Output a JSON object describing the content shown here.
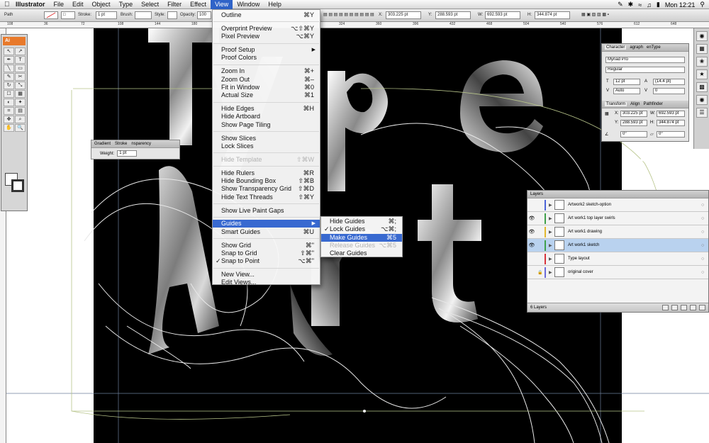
{
  "menubar": {
    "apple": "",
    "app": "Illustrator",
    "items": [
      "File",
      "Edit",
      "Object",
      "Type",
      "Select",
      "Filter",
      "Effect",
      "View",
      "Window",
      "Help"
    ],
    "active": "View",
    "clock": "Mon 12:21"
  },
  "controlbar": {
    "mode": "Path",
    "stroke_label": "Stroke:",
    "stroke_value": "1 pt",
    "brush_label": "Brush:",
    "style_label": "Style:",
    "opacity_label": "Opacity:",
    "opacity_value": "100",
    "x_label": "X:",
    "x_value": "303.225 pt",
    "y_label": "Y:",
    "y_value": "288.593 pt",
    "w_label": "W:",
    "w_value": "692.593 pt",
    "h_label": "H:",
    "h_value": "344.874 pt"
  },
  "ruler": {
    "ticks": [
      "108",
      "36",
      "72",
      "108",
      "144",
      "180",
      "216",
      "252",
      "288",
      "324",
      "360",
      "396",
      "432",
      "468",
      "504",
      "540",
      "576",
      "612",
      "648"
    ]
  },
  "tools": {
    "logo": "Ai",
    "buttons": [
      "↖",
      "↗",
      "✒",
      "T",
      "╲",
      "▭",
      "✎",
      "✂",
      "↻",
      "⤡",
      "☐",
      "▦",
      "◐",
      "✦",
      "⌗",
      "▤",
      "✥",
      "⌕",
      "✋",
      "🔍"
    ]
  },
  "stroke_panel": {
    "tabs": [
      "Gradient",
      "Stroke",
      "nsparency"
    ],
    "weight_label": "Weight:",
    "weight_value": "1 pt"
  },
  "char_panel": {
    "tabs": [
      "Character",
      "agraph",
      "enType"
    ],
    "font": "Myriad Pro",
    "style": "Regular",
    "size": "12 pt",
    "leading": "(14.4 pt)",
    "kerning": "Auto",
    "tracking": "0",
    "transform_tabs": [
      "Transform",
      "Align",
      "Pathfinder"
    ],
    "x": "303.225 pt",
    "y": "288.593 pt",
    "w": "692.593 pt",
    "h": "344.874 pt",
    "rotate": "0°",
    "shear": "0°"
  },
  "layers": {
    "title": "Layers",
    "items": [
      {
        "name": "Artwork2 sketch-option",
        "color": "#4a63d8",
        "visible": false,
        "locked": false,
        "selected": false
      },
      {
        "name": "Art work1 top layer swirls",
        "color": "#3fa04a",
        "visible": true,
        "locked": false,
        "selected": false
      },
      {
        "name": "Art work1 drawing",
        "color": "#e2b72f",
        "visible": true,
        "locked": false,
        "selected": false
      },
      {
        "name": "Art work1 sketch",
        "color": "#3fa04a",
        "visible": true,
        "locked": false,
        "selected": true
      },
      {
        "name": "Type layout",
        "color": "#d8343a",
        "visible": false,
        "locked": false,
        "selected": false
      },
      {
        "name": "original cover",
        "color": "#6b6bd8",
        "visible": false,
        "locked": true,
        "selected": false
      }
    ],
    "footer": "6 Layers"
  },
  "view_menu": {
    "items": [
      {
        "label": "Outline",
        "shortcut": "⌘Y"
      },
      {
        "sep": true
      },
      {
        "label": "Overprint Preview",
        "shortcut": "⌥⇧⌘Y"
      },
      {
        "label": "Pixel Preview",
        "shortcut": "⌥⌘Y"
      },
      {
        "sep": true
      },
      {
        "label": "Proof Setup",
        "submenu": true
      },
      {
        "label": "Proof Colors"
      },
      {
        "sep": true
      },
      {
        "label": "Zoom In",
        "shortcut": "⌘+"
      },
      {
        "label": "Zoom Out",
        "shortcut": "⌘–"
      },
      {
        "label": "Fit in Window",
        "shortcut": "⌘0"
      },
      {
        "label": "Actual Size",
        "shortcut": "⌘1"
      },
      {
        "sep": true
      },
      {
        "label": "Hide Edges",
        "shortcut": "⌘H"
      },
      {
        "label": "Hide Artboard"
      },
      {
        "label": "Show Page Tiling"
      },
      {
        "sep": true
      },
      {
        "label": "Show Slices"
      },
      {
        "label": "Lock Slices"
      },
      {
        "sep": true
      },
      {
        "label": "Hide Template",
        "shortcut": "⇧⌘W",
        "disabled": true
      },
      {
        "sep": true
      },
      {
        "label": "Hide Rulers",
        "shortcut": "⌘R"
      },
      {
        "label": "Hide Bounding Box",
        "shortcut": "⇧⌘B"
      },
      {
        "label": "Show Transparency Grid",
        "shortcut": "⇧⌘D"
      },
      {
        "label": "Hide Text Threads",
        "shortcut": "⇧⌘Y"
      },
      {
        "sep": true
      },
      {
        "label": "Show Live Paint Gaps"
      },
      {
        "sep": true
      },
      {
        "label": "Guides",
        "submenu": true,
        "highlighted": true
      },
      {
        "label": "Smart Guides",
        "shortcut": "⌘U"
      },
      {
        "sep": true
      },
      {
        "label": "Show Grid",
        "shortcut": "⌘\""
      },
      {
        "label": "Snap to Grid",
        "shortcut": "⇧⌘\""
      },
      {
        "label": "Snap to Point",
        "shortcut": "⌥⌘\"",
        "checked": true
      },
      {
        "sep": true
      },
      {
        "label": "New View..."
      },
      {
        "label": "Edit Views..."
      }
    ]
  },
  "guides_menu": {
    "items": [
      {
        "label": "Hide Guides",
        "shortcut": "⌘;"
      },
      {
        "label": "Lock Guides",
        "shortcut": "⌥⌘;",
        "checked": true
      },
      {
        "label": "Make Guides",
        "shortcut": "⌘5",
        "highlighted": true
      },
      {
        "label": "Release Guides",
        "shortcut": "⌥⌘5",
        "disabled": true
      },
      {
        "label": "Clear Guides"
      }
    ]
  }
}
